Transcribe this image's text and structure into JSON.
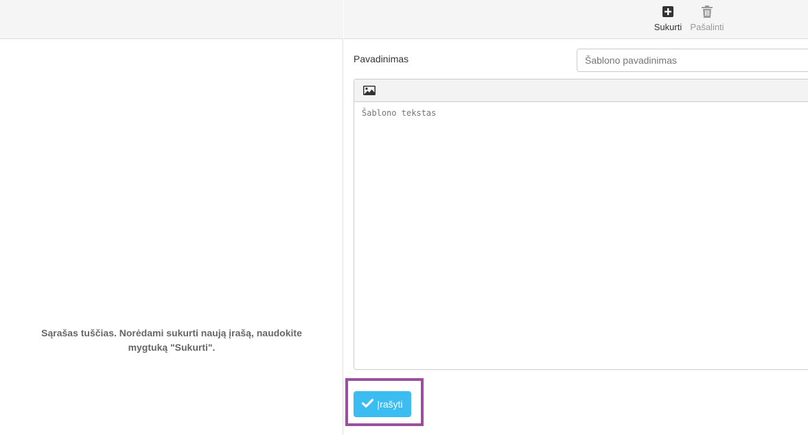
{
  "list": {
    "empty_message": "Sąrašas tuščias. Norėdami sukurti naują įrašą, naudokite mygtuką \"Sukurti\"."
  },
  "toolbar": {
    "create_label": "Sukurti",
    "create_icon": "plus-square-icon",
    "delete_label": "Pašalinti",
    "delete_icon": "trash-icon"
  },
  "form": {
    "name_label": "Pavadinimas",
    "name_placeholder": "Šablono pavadinimas",
    "name_value": "",
    "editor_image_icon": "image-icon",
    "text_placeholder": "Šablono tekstas",
    "text_value": ""
  },
  "actions": {
    "save_label": "Įrašyti",
    "save_icon": "check-icon"
  },
  "colors": {
    "save_button": "#3cbdf2",
    "highlight": "#9b4f9f",
    "header_bg": "#f5f5f5",
    "disabled_text": "#9a9a9a"
  }
}
